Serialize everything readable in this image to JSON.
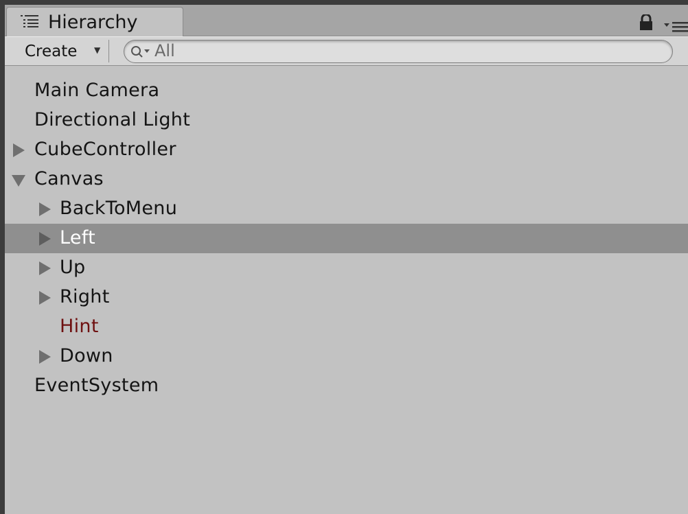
{
  "window": {
    "tab_title": "Hierarchy",
    "tab_icon": "hierarchy-list-icon"
  },
  "toolbar": {
    "create_label": "Create",
    "create_arrow": "▼",
    "search_placeholder": "All",
    "search_value": ""
  },
  "colors": {
    "panel": "#c2c2c2",
    "selection": "#8f8f8f",
    "missing_prefab_text": "#6e1010"
  },
  "tree": [
    {
      "label": "Main Camera",
      "depth": 0,
      "has_children": false,
      "expanded": false,
      "selected": false
    },
    {
      "label": "Directional Light",
      "depth": 0,
      "has_children": false,
      "expanded": false,
      "selected": false
    },
    {
      "label": "CubeController",
      "depth": 0,
      "has_children": true,
      "expanded": false,
      "selected": false
    },
    {
      "label": "Canvas",
      "depth": 0,
      "has_children": true,
      "expanded": true,
      "selected": false
    },
    {
      "label": "BackToMenu",
      "depth": 1,
      "has_children": true,
      "expanded": false,
      "selected": false
    },
    {
      "label": "Left",
      "depth": 1,
      "has_children": true,
      "expanded": false,
      "selected": true
    },
    {
      "label": "Up",
      "depth": 1,
      "has_children": true,
      "expanded": false,
      "selected": false
    },
    {
      "label": "Right",
      "depth": 1,
      "has_children": true,
      "expanded": false,
      "selected": false
    },
    {
      "label": "Hint",
      "depth": 1,
      "has_children": false,
      "expanded": false,
      "selected": false,
      "missing": true
    },
    {
      "label": "Down",
      "depth": 1,
      "has_children": true,
      "expanded": false,
      "selected": false
    },
    {
      "label": "EventSystem",
      "depth": 0,
      "has_children": false,
      "expanded": false,
      "selected": false
    }
  ]
}
